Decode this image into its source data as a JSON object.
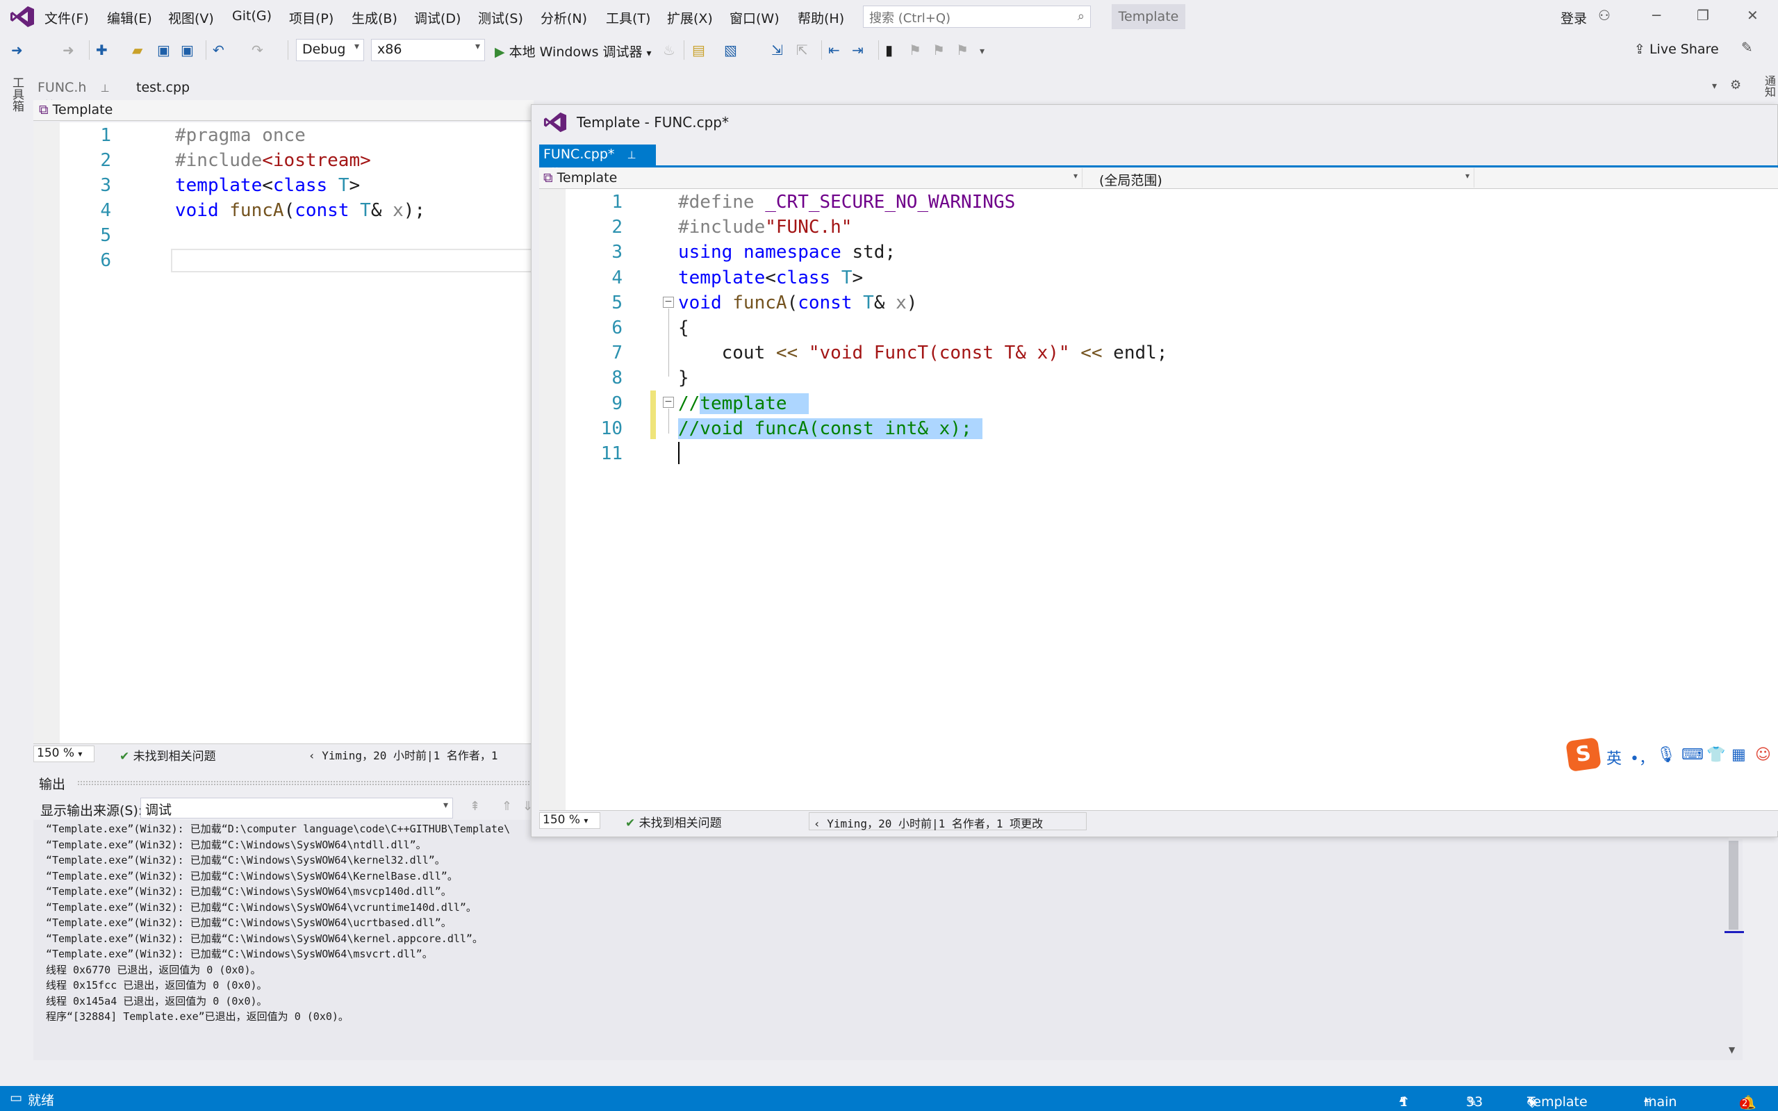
{
  "menu": {
    "items": [
      "文件(F)",
      "编辑(E)",
      "视图(V)",
      "Git(G)",
      "项目(P)",
      "生成(B)",
      "调试(D)",
      "测试(S)",
      "分析(N)",
      "工具(T)",
      "扩展(X)",
      "窗口(W)",
      "帮助(H)"
    ],
    "search_placeholder": "搜索 (Ctrl+Q)",
    "solution_name": "Template",
    "login": "登录"
  },
  "toolbar": {
    "config": "Debug",
    "platform": "x86",
    "run_label": "本地 Windows 调试器",
    "live_share": "Live Share"
  },
  "left_strip": {
    "label": "工具箱"
  },
  "left_editor": {
    "tabs": [
      {
        "label": "FUNC.h",
        "pin": "⊥",
        "close": "✕"
      },
      {
        "label": "test.cpp"
      }
    ],
    "nav_scope": "Template",
    "lines": [
      "1",
      "2",
      "3",
      "4",
      "5",
      "6"
    ],
    "zoom": "150 %",
    "issues": "未找到相关问题",
    "blame": "Yiming，20 小时前|1 名作者，1"
  },
  "float_window": {
    "title": "Template - FUNC.cpp*",
    "tab_label": "FUNC.cpp*",
    "nav_project": "Template",
    "nav_scope": "(全局范围)",
    "lines": [
      "1",
      "2",
      "3",
      "4",
      "5",
      "6",
      "7",
      "8",
      "9",
      "10",
      "11"
    ],
    "zoom": "150 %",
    "issues": "未找到相关问题",
    "blame": "Yiming，20 小时前|1 名作者，1 项更改"
  },
  "output": {
    "title": "输出",
    "source_label": "显示输出来源(S):",
    "source_value": "调试",
    "lines": [
      "“Template.exe”(Win32): 已加载“D:\\computer language\\code\\C++GITHUB\\Template\\",
      "“Template.exe”(Win32): 已加载“C:\\Windows\\SysWOW64\\ntdll.dll”。",
      "“Template.exe”(Win32): 已加载“C:\\Windows\\SysWOW64\\kernel32.dll”。",
      "“Template.exe”(Win32): 已加载“C:\\Windows\\SysWOW64\\KernelBase.dll”。",
      "“Template.exe”(Win32): 已加载“C:\\Windows\\SysWOW64\\msvcp140d.dll”。",
      "“Template.exe”(Win32): 已加载“C:\\Windows\\SysWOW64\\vcruntime140d.dll”。",
      "“Template.exe”(Win32): 已加载“C:\\Windows\\SysWOW64\\ucrtbased.dll”。",
      "“Template.exe”(Win32): 已加载“C:\\Windows\\SysWOW64\\kernel.appcore.dll”。",
      "“Template.exe”(Win32): 已加载“C:\\Windows\\SysWOW64\\msvcrt.dll”。",
      "线程 0x6770 已退出，返回值为 0 (0x0)。",
      "线程 0x15fcc 已退出，返回值为 0 (0x0)。",
      "线程 0x145a4 已退出，返回值为 0 (0x0)。",
      "程序“[32884] Template.exe”已退出，返回值为 0 (0x0)。"
    ]
  },
  "ime": {
    "lang": "英",
    "punct": "•，"
  },
  "statusbar": {
    "ready": "就绪",
    "arrow_count": "1",
    "edits": "33",
    "repo": "Template",
    "branch": "main",
    "notifications": "2"
  },
  "colors": {
    "accent": "#007acc",
    "selection": "#add6ff",
    "changebar": "#efe47a"
  }
}
